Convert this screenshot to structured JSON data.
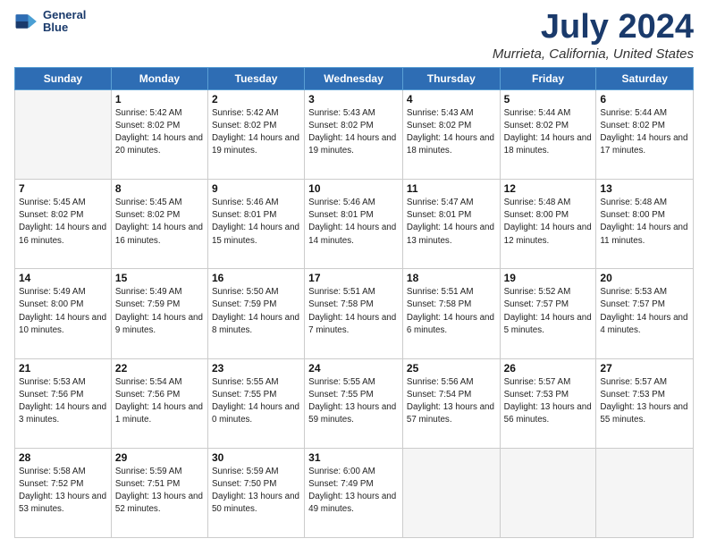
{
  "logo": {
    "line1": "General",
    "line2": "Blue"
  },
  "title": "July 2024",
  "subtitle": "Murrieta, California, United States",
  "header_days": [
    "Sunday",
    "Monday",
    "Tuesday",
    "Wednesday",
    "Thursday",
    "Friday",
    "Saturday"
  ],
  "weeks": [
    [
      {
        "day": "",
        "info": ""
      },
      {
        "day": "1",
        "info": "Sunrise: 5:42 AM\nSunset: 8:02 PM\nDaylight: 14 hours\nand 20 minutes."
      },
      {
        "day": "2",
        "info": "Sunrise: 5:42 AM\nSunset: 8:02 PM\nDaylight: 14 hours\nand 19 minutes."
      },
      {
        "day": "3",
        "info": "Sunrise: 5:43 AM\nSunset: 8:02 PM\nDaylight: 14 hours\nand 19 minutes."
      },
      {
        "day": "4",
        "info": "Sunrise: 5:43 AM\nSunset: 8:02 PM\nDaylight: 14 hours\nand 18 minutes."
      },
      {
        "day": "5",
        "info": "Sunrise: 5:44 AM\nSunset: 8:02 PM\nDaylight: 14 hours\nand 18 minutes."
      },
      {
        "day": "6",
        "info": "Sunrise: 5:44 AM\nSunset: 8:02 PM\nDaylight: 14 hours\nand 17 minutes."
      }
    ],
    [
      {
        "day": "7",
        "info": "Sunrise: 5:45 AM\nSunset: 8:02 PM\nDaylight: 14 hours\nand 16 minutes."
      },
      {
        "day": "8",
        "info": "Sunrise: 5:45 AM\nSunset: 8:02 PM\nDaylight: 14 hours\nand 16 minutes."
      },
      {
        "day": "9",
        "info": "Sunrise: 5:46 AM\nSunset: 8:01 PM\nDaylight: 14 hours\nand 15 minutes."
      },
      {
        "day": "10",
        "info": "Sunrise: 5:46 AM\nSunset: 8:01 PM\nDaylight: 14 hours\nand 14 minutes."
      },
      {
        "day": "11",
        "info": "Sunrise: 5:47 AM\nSunset: 8:01 PM\nDaylight: 14 hours\nand 13 minutes."
      },
      {
        "day": "12",
        "info": "Sunrise: 5:48 AM\nSunset: 8:00 PM\nDaylight: 14 hours\nand 12 minutes."
      },
      {
        "day": "13",
        "info": "Sunrise: 5:48 AM\nSunset: 8:00 PM\nDaylight: 14 hours\nand 11 minutes."
      }
    ],
    [
      {
        "day": "14",
        "info": "Sunrise: 5:49 AM\nSunset: 8:00 PM\nDaylight: 14 hours\nand 10 minutes."
      },
      {
        "day": "15",
        "info": "Sunrise: 5:49 AM\nSunset: 7:59 PM\nDaylight: 14 hours\nand 9 minutes."
      },
      {
        "day": "16",
        "info": "Sunrise: 5:50 AM\nSunset: 7:59 PM\nDaylight: 14 hours\nand 8 minutes."
      },
      {
        "day": "17",
        "info": "Sunrise: 5:51 AM\nSunset: 7:58 PM\nDaylight: 14 hours\nand 7 minutes."
      },
      {
        "day": "18",
        "info": "Sunrise: 5:51 AM\nSunset: 7:58 PM\nDaylight: 14 hours\nand 6 minutes."
      },
      {
        "day": "19",
        "info": "Sunrise: 5:52 AM\nSunset: 7:57 PM\nDaylight: 14 hours\nand 5 minutes."
      },
      {
        "day": "20",
        "info": "Sunrise: 5:53 AM\nSunset: 7:57 PM\nDaylight: 14 hours\nand 4 minutes."
      }
    ],
    [
      {
        "day": "21",
        "info": "Sunrise: 5:53 AM\nSunset: 7:56 PM\nDaylight: 14 hours\nand 3 minutes."
      },
      {
        "day": "22",
        "info": "Sunrise: 5:54 AM\nSunset: 7:56 PM\nDaylight: 14 hours\nand 1 minute."
      },
      {
        "day": "23",
        "info": "Sunrise: 5:55 AM\nSunset: 7:55 PM\nDaylight: 14 hours\nand 0 minutes."
      },
      {
        "day": "24",
        "info": "Sunrise: 5:55 AM\nSunset: 7:55 PM\nDaylight: 13 hours\nand 59 minutes."
      },
      {
        "day": "25",
        "info": "Sunrise: 5:56 AM\nSunset: 7:54 PM\nDaylight: 13 hours\nand 57 minutes."
      },
      {
        "day": "26",
        "info": "Sunrise: 5:57 AM\nSunset: 7:53 PM\nDaylight: 13 hours\nand 56 minutes."
      },
      {
        "day": "27",
        "info": "Sunrise: 5:57 AM\nSunset: 7:53 PM\nDaylight: 13 hours\nand 55 minutes."
      }
    ],
    [
      {
        "day": "28",
        "info": "Sunrise: 5:58 AM\nSunset: 7:52 PM\nDaylight: 13 hours\nand 53 minutes."
      },
      {
        "day": "29",
        "info": "Sunrise: 5:59 AM\nSunset: 7:51 PM\nDaylight: 13 hours\nand 52 minutes."
      },
      {
        "day": "30",
        "info": "Sunrise: 5:59 AM\nSunset: 7:50 PM\nDaylight: 13 hours\nand 50 minutes."
      },
      {
        "day": "31",
        "info": "Sunrise: 6:00 AM\nSunset: 7:49 PM\nDaylight: 13 hours\nand 49 minutes."
      },
      {
        "day": "",
        "info": ""
      },
      {
        "day": "",
        "info": ""
      },
      {
        "day": "",
        "info": ""
      }
    ]
  ]
}
